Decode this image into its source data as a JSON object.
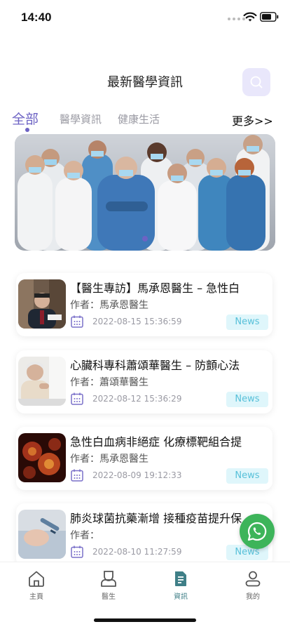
{
  "status": {
    "time": "14:40"
  },
  "header": {
    "title": "最新醫學資訊",
    "search_icon": "search-icon"
  },
  "tabs": [
    {
      "label": "全部",
      "active": true
    },
    {
      "label": "醫學資訊",
      "active": false
    },
    {
      "label": "健康生活",
      "active": false
    }
  ],
  "more_label": "更多>>",
  "banner": {
    "pages": 1,
    "current": 1
  },
  "articles": [
    {
      "title": "【醫生專訪】馬承恩醫生 – 急性白",
      "author_label": "作者：",
      "author": "馬承恩醫生",
      "date": "2022-08-15 15:36:59",
      "tag": "News"
    },
    {
      "title": "心臟科專科蕭頌華醫生 – 防顫心法",
      "author_label": "作者：",
      "author": "蕭頌華醫生",
      "date": "2022-08-12 15:36:29",
      "tag": "News"
    },
    {
      "title": "急性白血病非絕症 化療標靶組合提",
      "author_label": "作者：",
      "author": "馬承恩醫生",
      "date": "2022-08-09 19:12:33",
      "tag": "News"
    },
    {
      "title": "肺炎球菌抗藥漸增 接種疫苗提升保",
      "author_label": "作者：",
      "author": "",
      "date": "2022-08-10 11:27:59",
      "tag": "News"
    }
  ],
  "nav": [
    {
      "label": "主頁",
      "icon": "home-icon",
      "active": false
    },
    {
      "label": "醫生",
      "icon": "doctor-icon",
      "active": false
    },
    {
      "label": "資訊",
      "icon": "document-icon",
      "active": true
    },
    {
      "label": "我的",
      "icon": "user-icon",
      "active": false
    }
  ],
  "colors": {
    "accent": "#6d63c4",
    "tag_bg": "#dff6fb",
    "tag_text": "#57c0d9",
    "nav_active": "#3f7f87",
    "whatsapp": "#3db45a"
  }
}
